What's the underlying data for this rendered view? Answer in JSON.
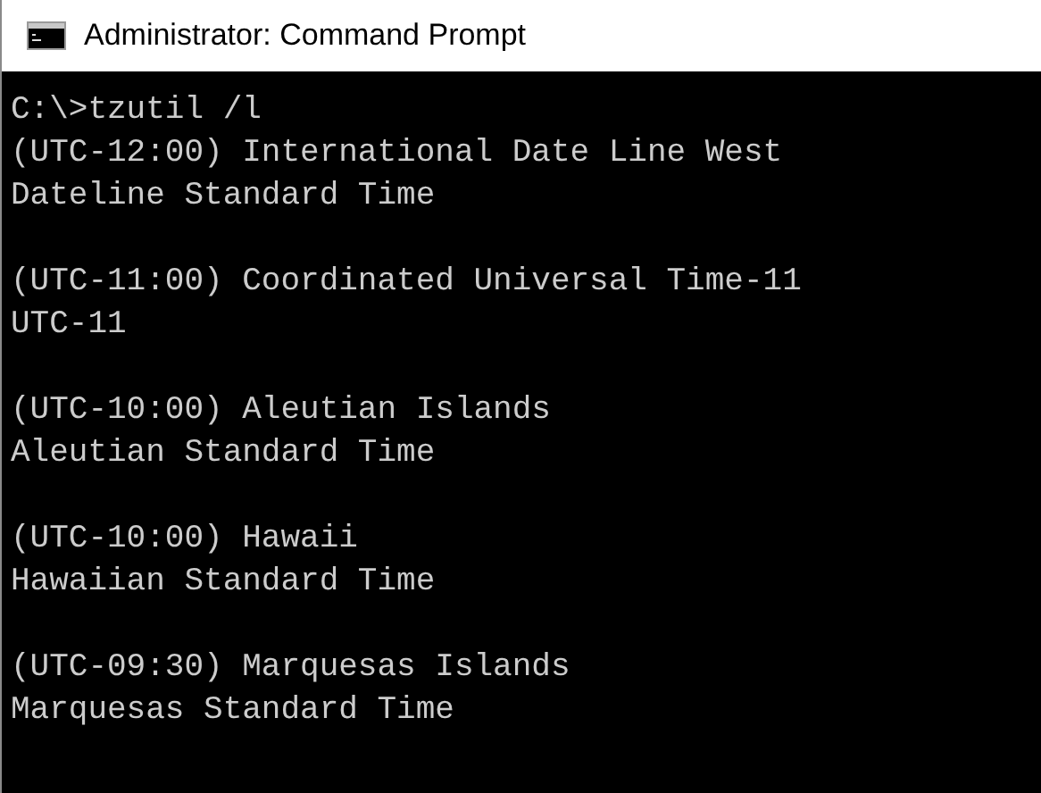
{
  "window": {
    "title": "Administrator: Command Prompt"
  },
  "console": {
    "command_line": "C:\\>tzutil /l",
    "entries": [
      {
        "display_name": "(UTC-12:00) International Date Line West",
        "id": "Dateline Standard Time"
      },
      {
        "display_name": "(UTC-11:00) Coordinated Universal Time-11",
        "id": "UTC-11"
      },
      {
        "display_name": "(UTC-10:00) Aleutian Islands",
        "id": "Aleutian Standard Time"
      },
      {
        "display_name": "(UTC-10:00) Hawaii",
        "id": "Hawaiian Standard Time"
      },
      {
        "display_name": "(UTC-09:30) Marquesas Islands",
        "id": "Marquesas Standard Time"
      }
    ]
  }
}
